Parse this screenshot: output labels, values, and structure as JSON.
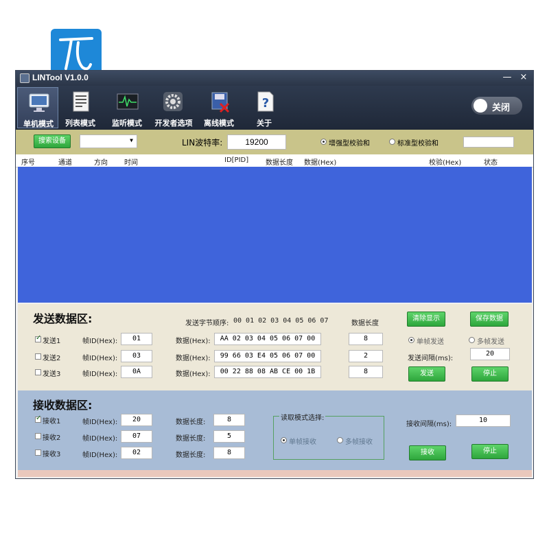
{
  "window": {
    "title": "LINTool V1.0.0",
    "close_symbol": "×",
    "minimize_symbol": "—"
  },
  "toolbar": {
    "items": [
      {
        "label": "单机模式",
        "icon": "monitor-icon"
      },
      {
        "label": "列表模式",
        "icon": "list-icon"
      },
      {
        "label": "监听模式",
        "icon": "waveform-icon"
      },
      {
        "label": "开发者选项",
        "icon": "gear-icon"
      },
      {
        "label": "离线模式",
        "icon": "disk-icon"
      },
      {
        "label": "关于",
        "icon": "help-icon"
      }
    ],
    "toggle_label": "关闭"
  },
  "config": {
    "search_device": "搜索设备",
    "baud_label": "LIN波特率:",
    "baud_value": "19200",
    "enhanced_checksum": "增强型校验和",
    "standard_checksum": "标准型校验和",
    "selected_checksum": "增强型校验和"
  },
  "table_headers": [
    "序号",
    "通道",
    "方向",
    "时间",
    "ID[PID]",
    "数据长度",
    "数据(Hex)",
    "校验(Hex)",
    "状态"
  ],
  "send": {
    "title": "发送数据区:",
    "byte_order_label": "发送字节顺序:",
    "byte_order": "00 01 02 03 04 05 06 07",
    "length_header": "数据长度",
    "clear_button": "清除显示",
    "save_button": "保存数据",
    "single_frame": "单帧发送",
    "multi_frame": "多帧发送",
    "interval_label": "发送间隔(ms):",
    "interval_value": "20",
    "send_button": "发送",
    "stop_button": "停止",
    "frame_id_label": "帧ID(Hex):",
    "data_label": "数据(Hex):",
    "rows": [
      {
        "label": "发送1",
        "checked": true,
        "id": "01",
        "data": "AA 02 03 04 05 06 07 00",
        "length": "8"
      },
      {
        "label": "发送2",
        "checked": false,
        "id": "03",
        "data": "99 66 03 E4 05 06 07 00",
        "length": "2"
      },
      {
        "label": "发送3",
        "checked": false,
        "id": "0A",
        "data": "00 22 88 08 AB CE 00 1B",
        "length": "8"
      }
    ]
  },
  "receive": {
    "title": "接收数据区:",
    "frame_id_label": "帧ID(Hex):",
    "length_label": "数据长度:",
    "mode_group": "读取模式选择:",
    "single_frame": "单帧接收",
    "multi_frame": "多帧接收",
    "interval_label": "接收间隔(ms):",
    "interval_value": "10",
    "receive_button": "接收",
    "stop_button": "停止",
    "rows": [
      {
        "label": "接收1",
        "checked": true,
        "id": "20",
        "length": "8"
      },
      {
        "label": "接收2",
        "checked": false,
        "id": "07",
        "length": "5"
      },
      {
        "label": "接收3",
        "checked": false,
        "id": "02",
        "length": "8"
      }
    ]
  },
  "colors": {
    "grid": "#3f64db",
    "config_bar": "#c9c48a",
    "send_area": "#ede8d8",
    "receive_area": "#a8bcd6",
    "button_green": "#2ea63c"
  }
}
